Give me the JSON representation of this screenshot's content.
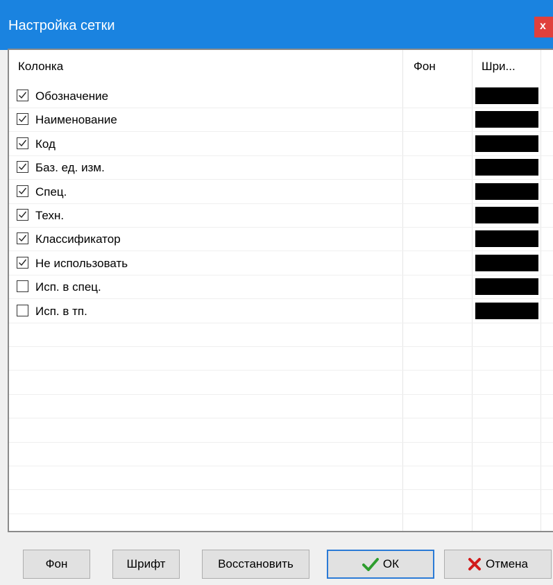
{
  "window": {
    "title": "Настройка сетки",
    "close_label": "x"
  },
  "grid": {
    "columns": [
      "Колонка",
      "Фон",
      "Шри..."
    ],
    "rows": [
      {
        "label": "Обозначение",
        "checked": true
      },
      {
        "label": "Наименование",
        "checked": true
      },
      {
        "label": "Код",
        "checked": true
      },
      {
        "label": "Баз. ед. изм.",
        "checked": true
      },
      {
        "label": "Спец.",
        "checked": true
      },
      {
        "label": "Техн.",
        "checked": true
      },
      {
        "label": "Классификатор",
        "checked": true
      },
      {
        "label": "Не использовать",
        "checked": true
      },
      {
        "label": "Исп. в спец.",
        "checked": false
      },
      {
        "label": "Исп. в тп.",
        "checked": false
      }
    ]
  },
  "buttons": {
    "background": "Фон",
    "font": "Шрифт",
    "restore": "Восстановить",
    "ok": "ОК",
    "cancel": "Отмена"
  },
  "colors": {
    "titlebar": "#1a83e0",
    "close": "#e0403c",
    "ok_icon": "#2e9d2e",
    "cancel_icon": "#d11a1a",
    "swatch": "#000000"
  },
  "icons": {
    "ok": "checkmark-icon",
    "cancel": "x-icon"
  }
}
